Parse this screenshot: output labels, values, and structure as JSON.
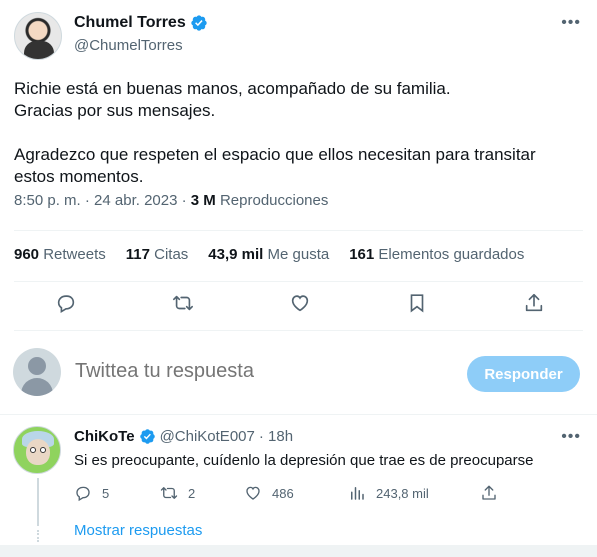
{
  "author": {
    "display_name": "Chumel Torres",
    "handle": "@ChumelTorres",
    "verified": true
  },
  "tweet": {
    "paragraph1_line1": "Richie está en buenas manos, acompañado de su familia.",
    "paragraph1_line2": "Gracias por sus mensajes.",
    "paragraph2_line1": "Agradezco que respeten el espacio que ellos necesitan para transitar",
    "paragraph2_line2": "estos momentos.",
    "timestamp": "8:50 p. m. · 24 abr. 2023 · ",
    "views_count": "3 M",
    "views_label": "Reproducciones"
  },
  "stats": {
    "retweets_count": "960",
    "retweets_label": "Retweets",
    "quotes_count": "117",
    "quotes_label": "Citas",
    "likes_count": "43,9 mil",
    "likes_label": "Me gusta",
    "bookmarks_count": "161",
    "bookmarks_label": "Elementos guardados"
  },
  "reply_composer": {
    "placeholder": "Twittea tu respuesta",
    "button_label": "Responder"
  },
  "reply": {
    "display_name": "ChiKoTe",
    "handle": "@ChiKotE007",
    "time": "· 18h",
    "text": "Si es preocupante, cuídenlo la depresión que trae es de preocuparse",
    "replies": "5",
    "retweets": "2",
    "likes": "486",
    "views": "243,8 mil",
    "show_replies": "Mostrar respuestas"
  },
  "colors": {
    "accent": "#1d9bf0",
    "muted": "#536471",
    "reply_button": "#8ecdf8"
  },
  "icons": {
    "reply": "reply-icon",
    "retweet": "retweet-icon",
    "like": "heart-icon",
    "bookmark": "bookmark-icon",
    "share": "share-icon",
    "views": "views-icon",
    "more": "more-icon",
    "verified": "verified-badge-icon"
  }
}
